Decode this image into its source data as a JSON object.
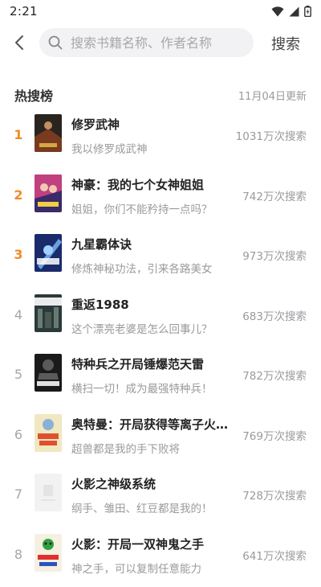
{
  "status_bar": {
    "time": "2:21",
    "icons": [
      "wifi-icon",
      "signal-icon",
      "battery-icon"
    ]
  },
  "search": {
    "placeholder": "搜索书籍名称、作者名称",
    "button_label": "搜索"
  },
  "hot_list": {
    "title": "热搜榜",
    "updated": "11月04日更新",
    "items": [
      {
        "rank": "1",
        "title": "修罗武神",
        "desc": "我以修罗成武神",
        "count": "1031万次搜索",
        "cover_colors": [
          "#2a2420",
          "#7a3a20"
        ]
      },
      {
        "rank": "2",
        "title": "神豪：我的七个女神姐姐",
        "desc": "姐姐，你们不能矜持一点吗？",
        "count": "742万次搜索",
        "cover_colors": [
          "#3a2a6a",
          "#c04080"
        ]
      },
      {
        "rank": "3",
        "title": "九星霸体诀",
        "desc": "修炼神秘功法，引来各路美女",
        "count": "973万次搜索",
        "cover_colors": [
          "#1a2a6a",
          "#6aa0e0"
        ]
      },
      {
        "rank": "4",
        "title": "重返1988",
        "desc": "这个漂亮老婆是怎么回事儿？",
        "count": "683万次搜索",
        "cover_colors": [
          "#2a3a3a",
          "#6a7a70"
        ]
      },
      {
        "rank": "5",
        "title": "特种兵之开局锤爆范天雷",
        "desc": "横扫一切！成为最强特种兵！",
        "count": "782万次搜索",
        "cover_colors": [
          "#1a1a1a",
          "#5a5a5a"
        ]
      },
      {
        "rank": "6",
        "title": "奥特曼：开局获得等离子火花塔",
        "desc": "超兽都是我的手下败将",
        "count": "769万次搜索",
        "cover_colors": [
          "#f0e8c0",
          "#e05030"
        ]
      },
      {
        "rank": "7",
        "title": "火影之神级系统",
        "desc": "纲手、雏田、红豆都是我的！",
        "count": "728万次搜索",
        "cover_colors": [
          "#f2f2f2",
          "#e4e4e4"
        ]
      },
      {
        "rank": "8",
        "title": "火影：开局一双神鬼之手",
        "desc": "神之手，可以复制任意能力",
        "count": "641万次搜索",
        "cover_colors": [
          "#f5f0e0",
          "#30a040"
        ]
      }
    ]
  },
  "colors": {
    "accent_rank": "#f08a26",
    "muted_text": "#9a9a9e",
    "search_bg": "#f2f2f4"
  }
}
